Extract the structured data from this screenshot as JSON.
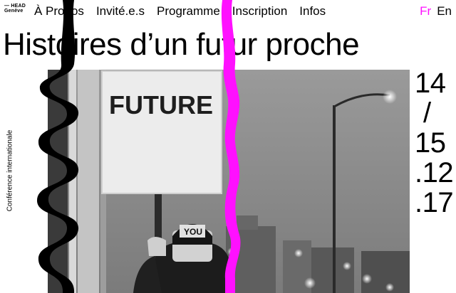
{
  "logo": {
    "line1": "— HEAD",
    "line2": "Genève"
  },
  "nav": {
    "items": [
      {
        "label": "À Propos"
      },
      {
        "label": "Invité.e.s"
      },
      {
        "label": "Programme"
      },
      {
        "label": "Inscription"
      },
      {
        "label": "Infos"
      }
    ]
  },
  "lang": {
    "fr": "Fr",
    "en": "En"
  },
  "title": "Histoires d’un futur proche",
  "subtitle_vertical": "Conférence internationale",
  "dates": {
    "d1": "14",
    "sep": "/",
    "d2": "15",
    "month": ".12",
    "year": ".17"
  },
  "photo": {
    "sign_top": "FUTURE",
    "sign_small": "YOU"
  },
  "colors": {
    "accent": "#ff10ff",
    "text": "#000000",
    "background": "#ffffff"
  }
}
